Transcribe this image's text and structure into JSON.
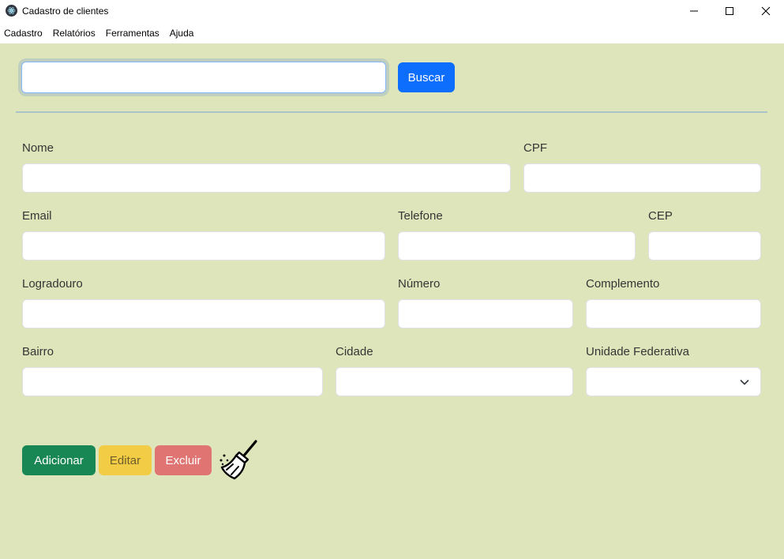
{
  "window": {
    "title": "Cadastro de clientes",
    "icon": "electron-app-icon",
    "controls": [
      "minimize-icon",
      "maximize-icon",
      "close-icon"
    ]
  },
  "menu": {
    "items": [
      "Cadastro",
      "Relatórios",
      "Ferramentas",
      "Ajuda"
    ]
  },
  "search": {
    "value": "",
    "placeholder": "",
    "button_label": "Buscar"
  },
  "form": {
    "nome": {
      "label": "Nome",
      "value": ""
    },
    "cpf": {
      "label": "CPF",
      "value": ""
    },
    "email": {
      "label": "Email",
      "value": ""
    },
    "telefone": {
      "label": "Telefone",
      "value": ""
    },
    "cep": {
      "label": "CEP",
      "value": ""
    },
    "logradouro": {
      "label": "Logradouro",
      "value": ""
    },
    "numero": {
      "label": "Número",
      "value": ""
    },
    "complemento": {
      "label": "Complemento",
      "value": ""
    },
    "bairro": {
      "label": "Bairro",
      "value": ""
    },
    "cidade": {
      "label": "Cidade",
      "value": ""
    },
    "uf": {
      "label": "Unidade Federativa",
      "selected": ""
    }
  },
  "actions": {
    "add_label": "Adicionar",
    "edit_label": "Editar",
    "delete_label": "Excluir",
    "clear_icon": "broom-icon"
  },
  "colors": {
    "background": "#dfe5bb",
    "primary": "#0d6efd",
    "success": "#198754",
    "warning": "#f3cc45",
    "danger": "#e07472"
  }
}
